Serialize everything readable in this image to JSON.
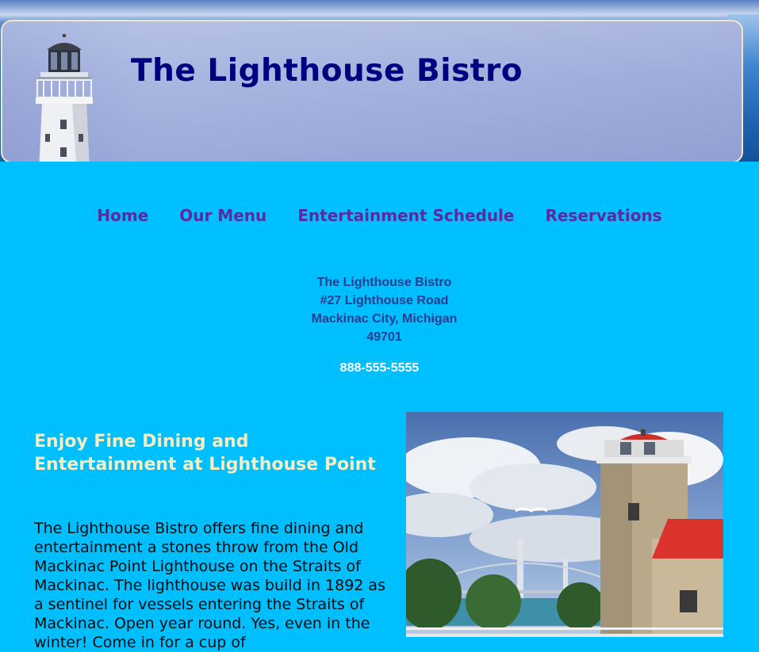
{
  "header": {
    "title": "The Lighthouse Bistro"
  },
  "nav": {
    "items": [
      {
        "label": "Home"
      },
      {
        "label": "Our Menu"
      },
      {
        "label": "Entertainment Schedule"
      },
      {
        "label": "Reservations"
      }
    ]
  },
  "address": {
    "lines": [
      "The Lighthouse Bistro",
      "#27 Lighthouse Road",
      "Mackinac City, Michigan",
      "49701"
    ],
    "phone": "888-555-5555"
  },
  "main": {
    "heading": "Enjoy Fine Dining and Entertainment at Lighthouse Point",
    "paragraph": "The Lighthouse Bistro offers fine dining and entertainment a stones throw from the Old Mackinac Point Lighthouse on the Straits of Mackinac. The lighthouse was build in 1892 as a sentinel for vessels entering the Straits of Mackinac. Open year round. Yes, even in the winter! Come in for a cup of"
  },
  "colors": {
    "page_background": "#00bfff",
    "title": "#000080",
    "nav_link": "#5b2aa0",
    "heading": "#f8ecc2"
  },
  "icons": {
    "banner_image": "lighthouse-tower",
    "photo": "lighthouse-photo"
  }
}
